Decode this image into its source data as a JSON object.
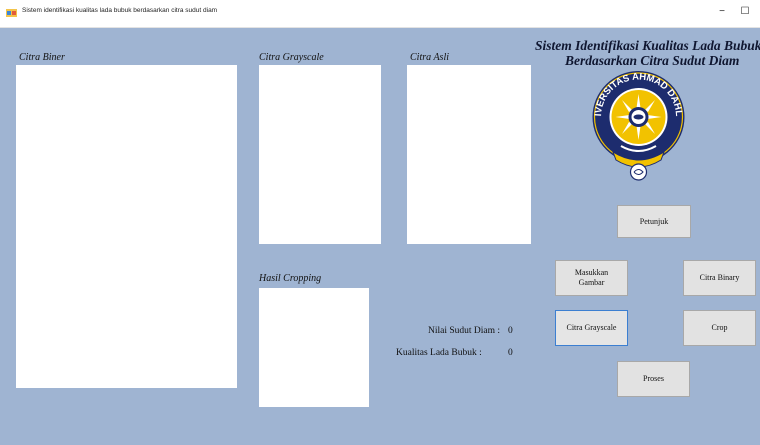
{
  "window": {
    "title": "Sistem identifikasi kualitas lada bubuk berdasarkan citra sudut diam",
    "minimize": "−",
    "maximize": "☐"
  },
  "panels": {
    "citra_biner": "Citra Biner",
    "citra_grayscale": "Citra Grayscale",
    "citra_asli": "Citra Asli",
    "hasil_cropping": "Hasil Cropping"
  },
  "header": {
    "line1": "Sistem Identifikasi Kualitas Lada Bubuk",
    "line2": "Berdasarkan Citra Sudut Diam"
  },
  "logo": {
    "ring_text": "UNIVERSITAS AHMAD DAHLAN",
    "colors": {
      "ring": "#1d2c6e",
      "gold": "#f2c200",
      "white": "#ffffff"
    }
  },
  "buttons": {
    "petunjuk": "Petunjuk",
    "masukkan_gambar_line1": "Masukkan",
    "masukkan_gambar_line2": "Gambar",
    "citra_binary": "Citra Binary",
    "citra_grayscale": "Citra Grayscale",
    "crop": "Crop",
    "proses": "Proses"
  },
  "results": {
    "sudut_label": "Nilai Sudut Diam :",
    "sudut_value": "0",
    "kualitas_label": "Kualitas Lada Bubuk :",
    "kualitas_value": "0"
  },
  "colors": {
    "client_bg": "#9fb4d2",
    "button_bg": "#e2e2e2",
    "focus_border": "#3c7fd1"
  }
}
